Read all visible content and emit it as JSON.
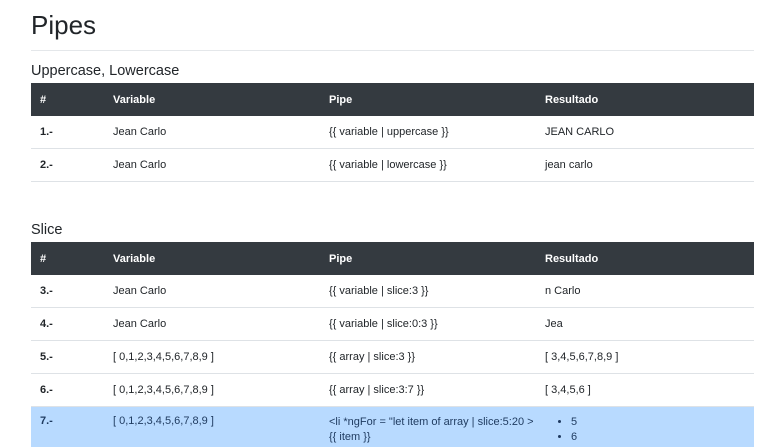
{
  "page": {
    "title": "Pipes"
  },
  "columns": [
    "#",
    "Variable",
    "Pipe",
    "Resultado"
  ],
  "sections": [
    {
      "heading": "Uppercase, Lowercase",
      "rows": [
        {
          "num": "1.-",
          "variable": "Jean Carlo",
          "pipe": "{{ variable | uppercase }}",
          "result": "JEAN CARLO"
        },
        {
          "num": "2.-",
          "variable": "Jean Carlo",
          "pipe": "{{ variable | lowercase }}",
          "result": "jean carlo"
        }
      ]
    },
    {
      "heading": "Slice",
      "rows": [
        {
          "num": "3.-",
          "variable": "Jean Carlo",
          "pipe": "{{ variable | slice:3 }}",
          "result": "n Carlo"
        },
        {
          "num": "4.-",
          "variable": "Jean Carlo",
          "pipe": "{{ variable | slice:0:3 }}",
          "result": "Jea"
        },
        {
          "num": "5.-",
          "variable": "[ 0,1,2,3,4,5,6,7,8,9 ]",
          "pipe": "{{ array | slice:3 }}",
          "result": "[ 3,4,5,6,7,8,9 ]"
        },
        {
          "num": "6.-",
          "variable": "[ 0,1,2,3,4,5,6,7,8,9 ]",
          "pipe": "{{ array | slice:3:7 }}",
          "result": "[ 3,4,5,6 ]"
        },
        {
          "num": "7.-",
          "variable": "[ 0,1,2,3,4,5,6,7,8,9 ]",
          "pipe": "<li *ngFor = \"let item of array | slice:5:20 > {{ item }}",
          "result_items": [
            "5",
            "6"
          ]
        }
      ]
    }
  ]
}
